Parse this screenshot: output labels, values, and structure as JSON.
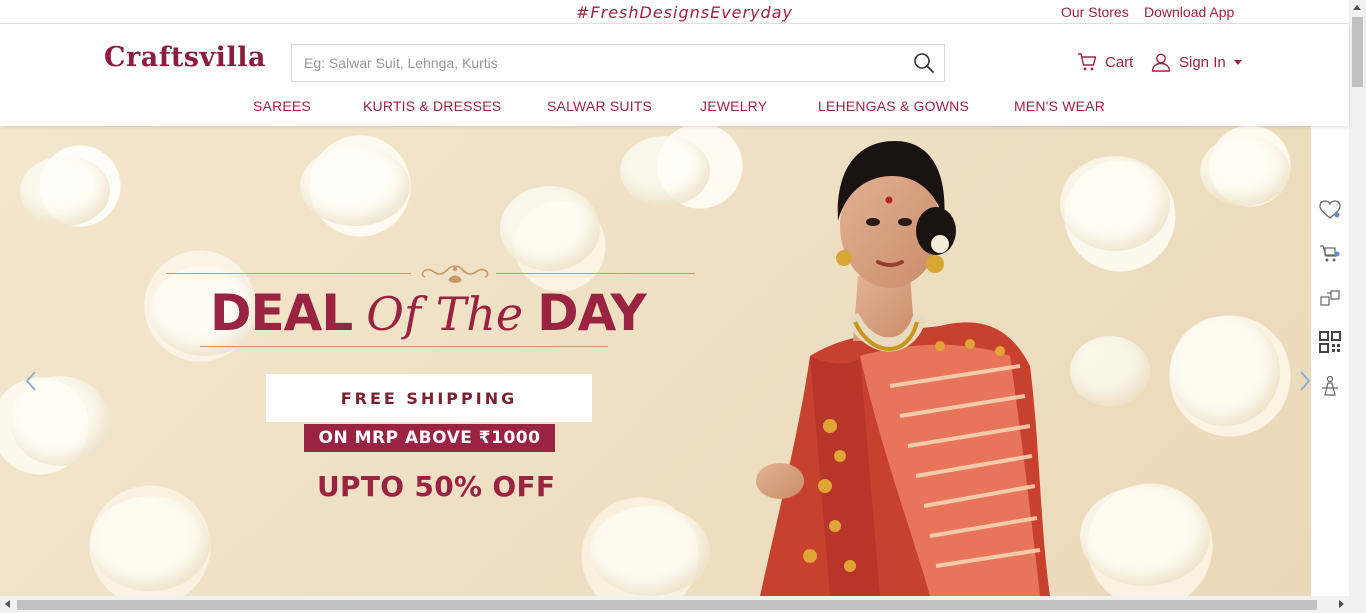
{
  "topbar": {
    "tagline": "#FreshDesignsEveryday",
    "our_stores": "Our Stores",
    "download_app": "Download App"
  },
  "header": {
    "logo": "Craftsvilla",
    "search_placeholder": "Eg: Salwar Suit, Lehnga, Kurtis",
    "cart_label": "Cart",
    "signin_label": "Sign In"
  },
  "nav": {
    "items": [
      {
        "label": "SAREES"
      },
      {
        "label": "KURTIS & DRESSES"
      },
      {
        "label": "SALWAR SUITS"
      },
      {
        "label": "JEWELRY"
      },
      {
        "label": "LEHENGAS & GOWNS"
      },
      {
        "label": "MEN'S WEAR"
      }
    ]
  },
  "hero": {
    "deal_word1": "DEAL",
    "deal_script": "Of The",
    "deal_word2": "DAY",
    "free_shipping": "FREE SHIPPING",
    "mrp_above": "ON MRP ABOVE ₹1000",
    "upto": "UPTO 50% OFF"
  },
  "side_rail": {
    "icons": [
      "wishlist-heart-icon",
      "track-order-icon",
      "exchange-icon",
      "qr-code-icon",
      "stylist-icon"
    ]
  },
  "colors": {
    "brand": "#9b2342",
    "hero_bg": "#efe1c5"
  }
}
